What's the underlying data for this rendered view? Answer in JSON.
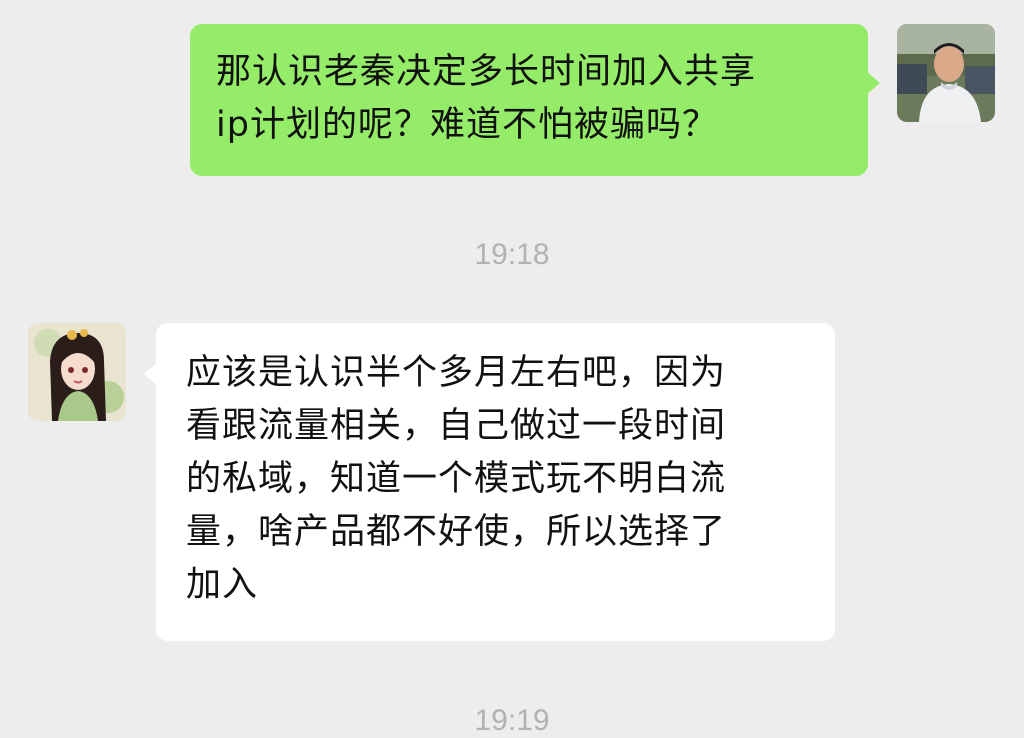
{
  "messages": [
    {
      "sender": "me",
      "avatar_icon": "user-photo-avatar",
      "text": "那认识老秦决定多长时间加入共享\nip计划的呢？难道不怕被骗吗？"
    },
    {
      "sender": "other",
      "avatar_icon": "anime-girl-avatar",
      "text": "应该是认识半个多月左右吧，因为\n看跟流量相关，自己做过一段时间\n的私域，知道一个模式玩不明白流\n量，啥产品都不好使，所以选择了\n加入"
    }
  ],
  "timestamps": [
    "19:18",
    "19:19"
  ],
  "colors": {
    "background": "#ededed",
    "my_bubble": "#95ec69",
    "other_bubble": "#ffffff",
    "timestamp": "#b2b2b2"
  }
}
